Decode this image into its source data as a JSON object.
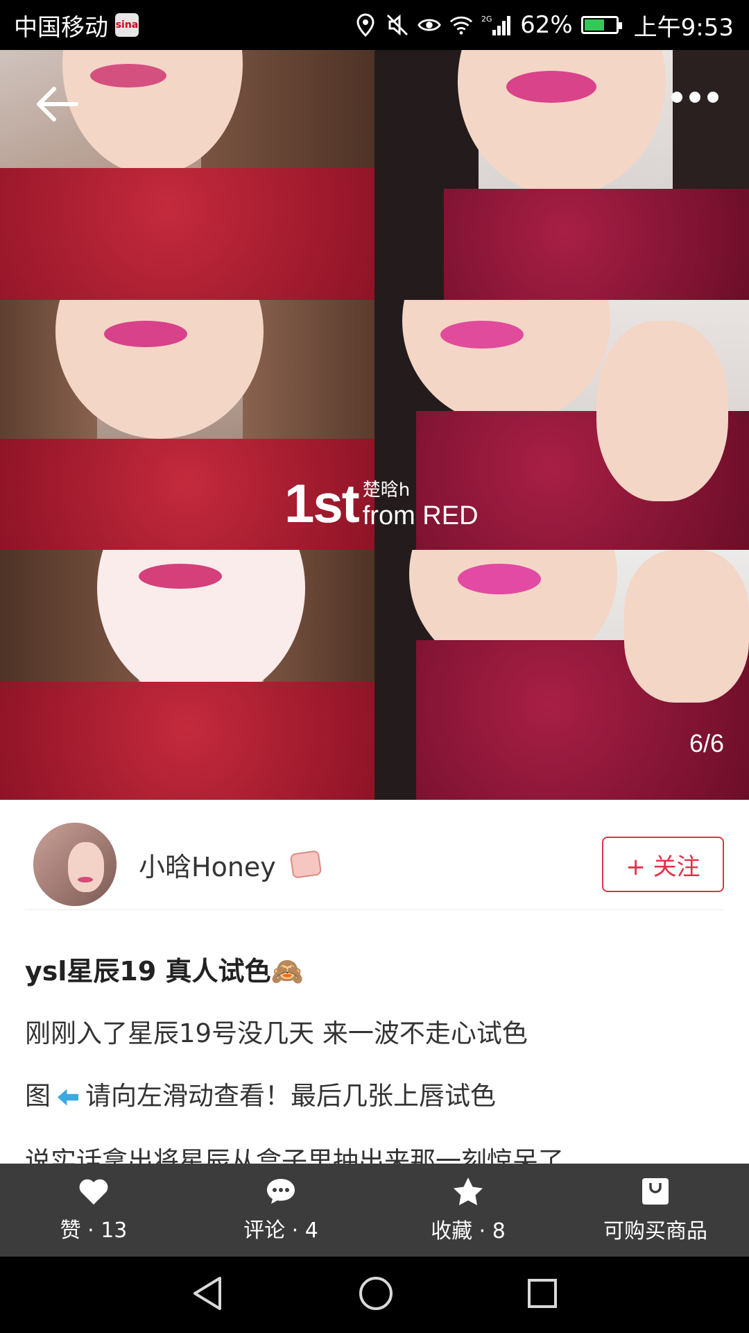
{
  "status_bar": {
    "carrier": "中国移动",
    "network": "2G",
    "battery": "62%",
    "time": "上午9:53"
  },
  "gallery": {
    "watermark_badge": "1st",
    "watermark_user": "楚晗h",
    "watermark_from": "from RED",
    "page_indicator": "6/6"
  },
  "author": {
    "name": "小晗Honey",
    "follow_label": "+ 关注"
  },
  "post": {
    "title": "ysl星辰19 真人试色🙈",
    "line1": "刚刚入了星辰19号没几天 来一波不走心试色",
    "line2_prefix": "图",
    "line2_suffix": "请向左滑动查看！最后几张上唇试色",
    "line3": "说实话拿出将星辰从盒子里抽出来那一刻惊呆了"
  },
  "actions": {
    "like": "赞 · 13",
    "comment": "评论 · 4",
    "collect": "收藏 · 8",
    "shop": "可购买商品"
  },
  "colors": {
    "accent": "#e0324a",
    "action_bar": "#3c3c3c",
    "sweater": "#a8182e"
  }
}
